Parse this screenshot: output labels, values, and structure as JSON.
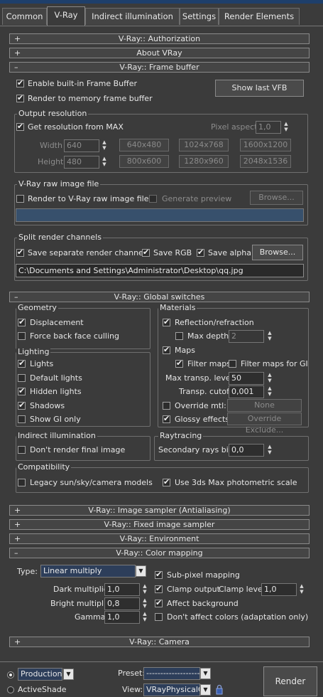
{
  "tabs": [
    "Common",
    "V-Ray",
    "Indirect illumination",
    "Settings",
    "Render Elements"
  ],
  "rollouts": {
    "authorization": {
      "sign": "+",
      "title": "V-Ray:: Authorization"
    },
    "about": {
      "sign": "+",
      "title": "About VRay"
    },
    "frame_buffer": {
      "sign": "–",
      "title": "V-Ray:: Frame buffer"
    },
    "global_switches": {
      "sign": "–",
      "title": "V-Ray:: Global switches"
    },
    "image_sampler": {
      "sign": "+",
      "title": "V-Ray:: Image sampler (Antialiasing)"
    },
    "fixed_sampler": {
      "sign": "+",
      "title": "V-Ray:: Fixed image sampler"
    },
    "environment": {
      "sign": "+",
      "title": "V-Ray:: Environment"
    },
    "color_mapping": {
      "sign": "–",
      "title": "V-Ray:: Color mapping"
    },
    "camera": {
      "sign": "+",
      "title": "V-Ray:: Camera"
    }
  },
  "frame_buffer": {
    "enable_builtin": "Enable built-in Frame Buffer",
    "render_to_memory": "Render to memory frame buffer",
    "show_last_vfb": "Show last VFB",
    "output_resolution": "Output resolution",
    "get_resolution": "Get resolution from MAX",
    "pixel_aspect_label": "Pixel aspect:",
    "pixel_aspect": "1,0",
    "width_label": "Width",
    "width": "640",
    "height_label": "Height",
    "height": "480",
    "presets": [
      "640x480",
      "1024x768",
      "1600x1200",
      "800x600",
      "1280x960",
      "2048x1536"
    ],
    "raw_group": "V-Ray raw image file",
    "render_raw": "Render to V-Ray raw image file",
    "generate_preview": "Generate preview",
    "browse_raw": "Browse...",
    "split_group": "Split render channels",
    "save_separate": "Save separate render channels",
    "save_rgb": "Save RGB",
    "save_alpha": "Save alpha",
    "browse_split": "Browse...",
    "split_path": "C:\\Documents and Settings\\Administrator\\Desktop\\qq.jpg"
  },
  "global_switches": {
    "geometry": "Geometry",
    "displacement": "Displacement",
    "force_back_face": "Force back face culling",
    "lighting": "Lighting",
    "lights": "Lights",
    "default_lights": "Default lights",
    "hidden_lights": "Hidden lights",
    "shadows": "Shadows",
    "show_gi_only": "Show GI only",
    "materials": "Materials",
    "reflection_refraction": "Reflection/refraction",
    "max_depth": "Max depth",
    "max_depth_value": "2",
    "maps": "Maps",
    "filter_maps": "Filter maps",
    "filter_maps_gi": "Filter maps for GI",
    "max_transp_levels": "Max transp. levels",
    "max_transp_value": "50",
    "transp_cutoff": "Transp. cutoff",
    "transp_cutoff_value": "0,001",
    "override_mtl": "Override mtl:",
    "override_none": "None",
    "glossy_effects": "Glossy effects",
    "override_exclude": "Override Exclude...",
    "indirect_illumination": "Indirect illumination",
    "dont_render_final": "Don't render final image",
    "raytracing": "Raytracing",
    "secondary_rays_bias": "Secondary rays bias",
    "secondary_rays_bias_value": "0,0",
    "compatibility": "Compatibility",
    "legacy_sun": "Legacy sun/sky/camera models",
    "use_photometric": "Use 3ds Max photometric scale"
  },
  "color_mapping": {
    "type_label": "Type:",
    "type_value": "Linear multiply",
    "sub_pixel": "Sub-pixel mapping",
    "dark_multiplier": "Dark multiplier:",
    "dark_value": "1,0",
    "clamp_output": "Clamp output",
    "clamp_level": "Clamp level:",
    "clamp_level_value": "1,0",
    "bright_multiplier": "Bright multiplier:",
    "bright_value": "0,8",
    "affect_background": "Affect background",
    "gamma": "Gamma:",
    "gamma_value": "1,0",
    "dont_affect_colors": "Don't affect colors (adaptation only)"
  },
  "bottom": {
    "production": "Production",
    "activeshade": "ActiveShade",
    "preset_label": "Preset:",
    "preset_value": "--------------------------",
    "view_label": "View:",
    "view_value": "VRayPhysicalCa",
    "render": "Render"
  }
}
